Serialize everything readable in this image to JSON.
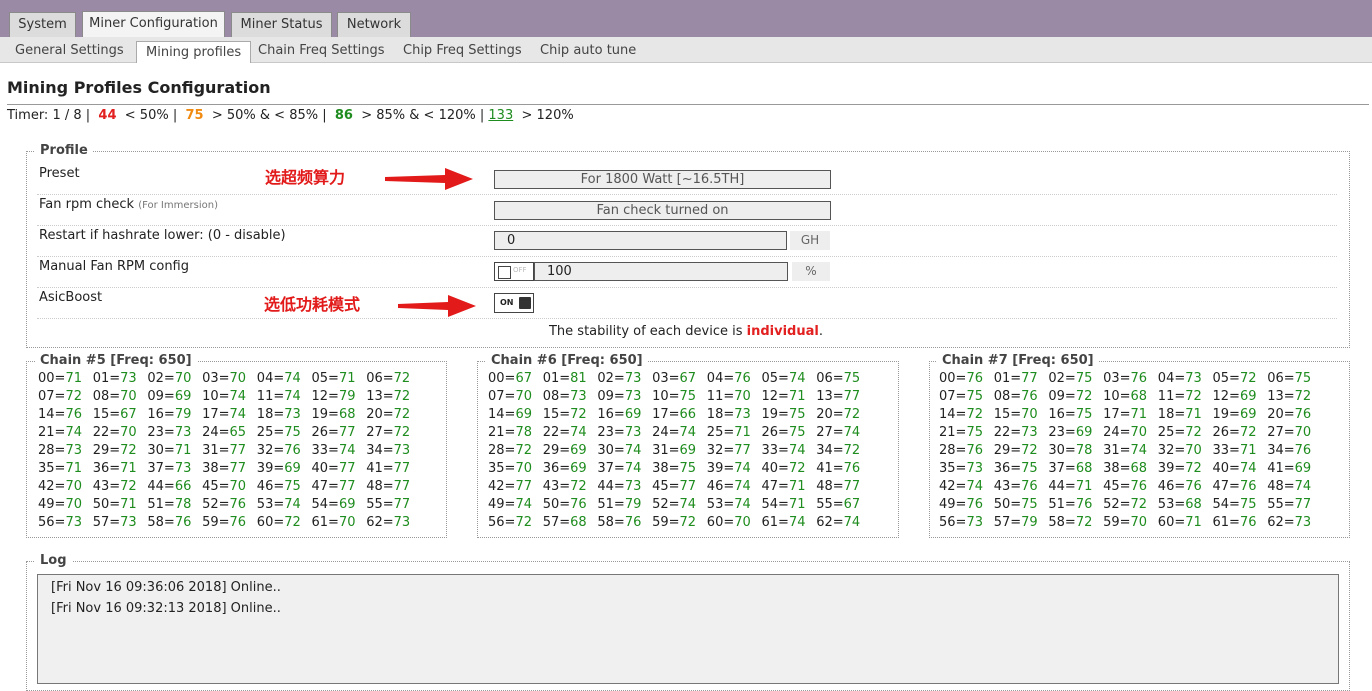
{
  "tabs": [
    "System",
    "Miner Configuration",
    "Miner Status",
    "Network"
  ],
  "subtabs": [
    "General Settings",
    "Mining profiles",
    "Chain Freq Settings",
    "Chip Freq Settings",
    "Chip auto tune"
  ],
  "page_title": "Mining Profiles Configuration",
  "timer": {
    "prefix": "Timer: 1 / 8 |",
    "v44": "44",
    "t44": "< 50% |",
    "v75": "75",
    "t75": "> 50% & < 85% |",
    "v86": "86",
    "t86": "> 85% & < 120% |",
    "v133": "133",
    "t133": "> 120%"
  },
  "profile": {
    "legend": "Profile",
    "preset_label": "Preset",
    "preset_value": "For 1800 Watt [~16.5TH]",
    "fan_label": "Fan rpm check",
    "fan_note": "(For Immersion)",
    "fan_value": "Fan check turned on",
    "restart_label": "Restart if hashrate lower: (0 - disable)",
    "restart_value": "0",
    "restart_unit": "GH",
    "manual_fan_label": "Manual Fan RPM config",
    "manual_fan_toggle": "OFF",
    "manual_fan_value": "100",
    "manual_fan_unit": "%",
    "asicboost_label": "AsicBoost",
    "asicboost_toggle": "ON",
    "stability_prefix": "The stability of each device is",
    "stability_value": "individual",
    "stability_suffix": "."
  },
  "annotations": {
    "note1": "选超频算力",
    "note2": "选低功耗模式"
  },
  "chains": [
    {
      "title": "Chain #5 [Freq: 650]",
      "chips": [
        [
          "00",
          "71"
        ],
        [
          "01",
          "73"
        ],
        [
          "02",
          "70"
        ],
        [
          "03",
          "70"
        ],
        [
          "04",
          "74"
        ],
        [
          "05",
          "71"
        ],
        [
          "06",
          "72"
        ],
        [
          "07",
          "72"
        ],
        [
          "08",
          "70"
        ],
        [
          "09",
          "69"
        ],
        [
          "10",
          "74"
        ],
        [
          "11",
          "74"
        ],
        [
          "12",
          "79"
        ],
        [
          "13",
          "72"
        ],
        [
          "14",
          "76"
        ],
        [
          "15",
          "67"
        ],
        [
          "16",
          "79"
        ],
        [
          "17",
          "74"
        ],
        [
          "18",
          "73"
        ],
        [
          "19",
          "68"
        ],
        [
          "20",
          "72"
        ],
        [
          "21",
          "74"
        ],
        [
          "22",
          "70"
        ],
        [
          "23",
          "73"
        ],
        [
          "24",
          "65"
        ],
        [
          "25",
          "75"
        ],
        [
          "26",
          "77"
        ],
        [
          "27",
          "72"
        ],
        [
          "28",
          "73"
        ],
        [
          "29",
          "72"
        ],
        [
          "30",
          "71"
        ],
        [
          "31",
          "77"
        ],
        [
          "32",
          "76"
        ],
        [
          "33",
          "74"
        ],
        [
          "34",
          "73"
        ],
        [
          "35",
          "71"
        ],
        [
          "36",
          "71"
        ],
        [
          "37",
          "73"
        ],
        [
          "38",
          "77"
        ],
        [
          "39",
          "69"
        ],
        [
          "40",
          "77"
        ],
        [
          "41",
          "77"
        ],
        [
          "42",
          "70"
        ],
        [
          "43",
          "72"
        ],
        [
          "44",
          "66"
        ],
        [
          "45",
          "70"
        ],
        [
          "46",
          "75"
        ],
        [
          "47",
          "77"
        ],
        [
          "48",
          "77"
        ],
        [
          "49",
          "70"
        ],
        [
          "50",
          "71"
        ],
        [
          "51",
          "78"
        ],
        [
          "52",
          "76"
        ],
        [
          "53",
          "74"
        ],
        [
          "54",
          "69"
        ],
        [
          "55",
          "77"
        ],
        [
          "56",
          "73"
        ],
        [
          "57",
          "73"
        ],
        [
          "58",
          "76"
        ],
        [
          "59",
          "76"
        ],
        [
          "60",
          "72"
        ],
        [
          "61",
          "70"
        ],
        [
          "62",
          "73"
        ]
      ]
    },
    {
      "title": "Chain #6 [Freq: 650]",
      "chips": [
        [
          "00",
          "67"
        ],
        [
          "01",
          "81"
        ],
        [
          "02",
          "73"
        ],
        [
          "03",
          "67"
        ],
        [
          "04",
          "76"
        ],
        [
          "05",
          "74"
        ],
        [
          "06",
          "75"
        ],
        [
          "07",
          "70"
        ],
        [
          "08",
          "73"
        ],
        [
          "09",
          "73"
        ],
        [
          "10",
          "75"
        ],
        [
          "11",
          "70"
        ],
        [
          "12",
          "71"
        ],
        [
          "13",
          "77"
        ],
        [
          "14",
          "69"
        ],
        [
          "15",
          "72"
        ],
        [
          "16",
          "69"
        ],
        [
          "17",
          "66"
        ],
        [
          "18",
          "73"
        ],
        [
          "19",
          "75"
        ],
        [
          "20",
          "72"
        ],
        [
          "21",
          "78"
        ],
        [
          "22",
          "74"
        ],
        [
          "23",
          "73"
        ],
        [
          "24",
          "74"
        ],
        [
          "25",
          "71"
        ],
        [
          "26",
          "75"
        ],
        [
          "27",
          "74"
        ],
        [
          "28",
          "72"
        ],
        [
          "29",
          "69"
        ],
        [
          "30",
          "74"
        ],
        [
          "31",
          "69"
        ],
        [
          "32",
          "77"
        ],
        [
          "33",
          "74"
        ],
        [
          "34",
          "72"
        ],
        [
          "35",
          "70"
        ],
        [
          "36",
          "69"
        ],
        [
          "37",
          "74"
        ],
        [
          "38",
          "75"
        ],
        [
          "39",
          "74"
        ],
        [
          "40",
          "72"
        ],
        [
          "41",
          "76"
        ],
        [
          "42",
          "77"
        ],
        [
          "43",
          "72"
        ],
        [
          "44",
          "73"
        ],
        [
          "45",
          "77"
        ],
        [
          "46",
          "74"
        ],
        [
          "47",
          "71"
        ],
        [
          "48",
          "77"
        ],
        [
          "49",
          "74"
        ],
        [
          "50",
          "76"
        ],
        [
          "51",
          "79"
        ],
        [
          "52",
          "74"
        ],
        [
          "53",
          "74"
        ],
        [
          "54",
          "71"
        ],
        [
          "55",
          "67"
        ],
        [
          "56",
          "72"
        ],
        [
          "57",
          "68"
        ],
        [
          "58",
          "76"
        ],
        [
          "59",
          "72"
        ],
        [
          "60",
          "70"
        ],
        [
          "61",
          "74"
        ],
        [
          "62",
          "74"
        ]
      ]
    },
    {
      "title": "Chain #7 [Freq: 650]",
      "chips": [
        [
          "00",
          "76"
        ],
        [
          "01",
          "77"
        ],
        [
          "02",
          "75"
        ],
        [
          "03",
          "76"
        ],
        [
          "04",
          "73"
        ],
        [
          "05",
          "72"
        ],
        [
          "06",
          "75"
        ],
        [
          "07",
          "75"
        ],
        [
          "08",
          "76"
        ],
        [
          "09",
          "72"
        ],
        [
          "10",
          "68"
        ],
        [
          "11",
          "72"
        ],
        [
          "12",
          "69"
        ],
        [
          "13",
          "72"
        ],
        [
          "14",
          "72"
        ],
        [
          "15",
          "70"
        ],
        [
          "16",
          "75"
        ],
        [
          "17",
          "71"
        ],
        [
          "18",
          "71"
        ],
        [
          "19",
          "69"
        ],
        [
          "20",
          "76"
        ],
        [
          "21",
          "75"
        ],
        [
          "22",
          "73"
        ],
        [
          "23",
          "69"
        ],
        [
          "24",
          "70"
        ],
        [
          "25",
          "72"
        ],
        [
          "26",
          "72"
        ],
        [
          "27",
          "70"
        ],
        [
          "28",
          "76"
        ],
        [
          "29",
          "72"
        ],
        [
          "30",
          "78"
        ],
        [
          "31",
          "74"
        ],
        [
          "32",
          "70"
        ],
        [
          "33",
          "71"
        ],
        [
          "34",
          "76"
        ],
        [
          "35",
          "73"
        ],
        [
          "36",
          "75"
        ],
        [
          "37",
          "68"
        ],
        [
          "38",
          "68"
        ],
        [
          "39",
          "72"
        ],
        [
          "40",
          "74"
        ],
        [
          "41",
          "69"
        ],
        [
          "42",
          "74"
        ],
        [
          "43",
          "76"
        ],
        [
          "44",
          "71"
        ],
        [
          "45",
          "76"
        ],
        [
          "46",
          "76"
        ],
        [
          "47",
          "76"
        ],
        [
          "48",
          "74"
        ],
        [
          "49",
          "76"
        ],
        [
          "50",
          "75"
        ],
        [
          "51",
          "76"
        ],
        [
          "52",
          "72"
        ],
        [
          "53",
          "68"
        ],
        [
          "54",
          "75"
        ],
        [
          "55",
          "77"
        ],
        [
          "56",
          "73"
        ],
        [
          "57",
          "79"
        ],
        [
          "58",
          "72"
        ],
        [
          "59",
          "70"
        ],
        [
          "60",
          "71"
        ],
        [
          "61",
          "76"
        ],
        [
          "62",
          "73"
        ]
      ]
    }
  ],
  "log": {
    "legend": "Log",
    "lines": [
      "[Fri Nov 16 09:36:06 2018] Online..",
      "[Fri Nov 16 09:32:13 2018] Online.."
    ]
  }
}
